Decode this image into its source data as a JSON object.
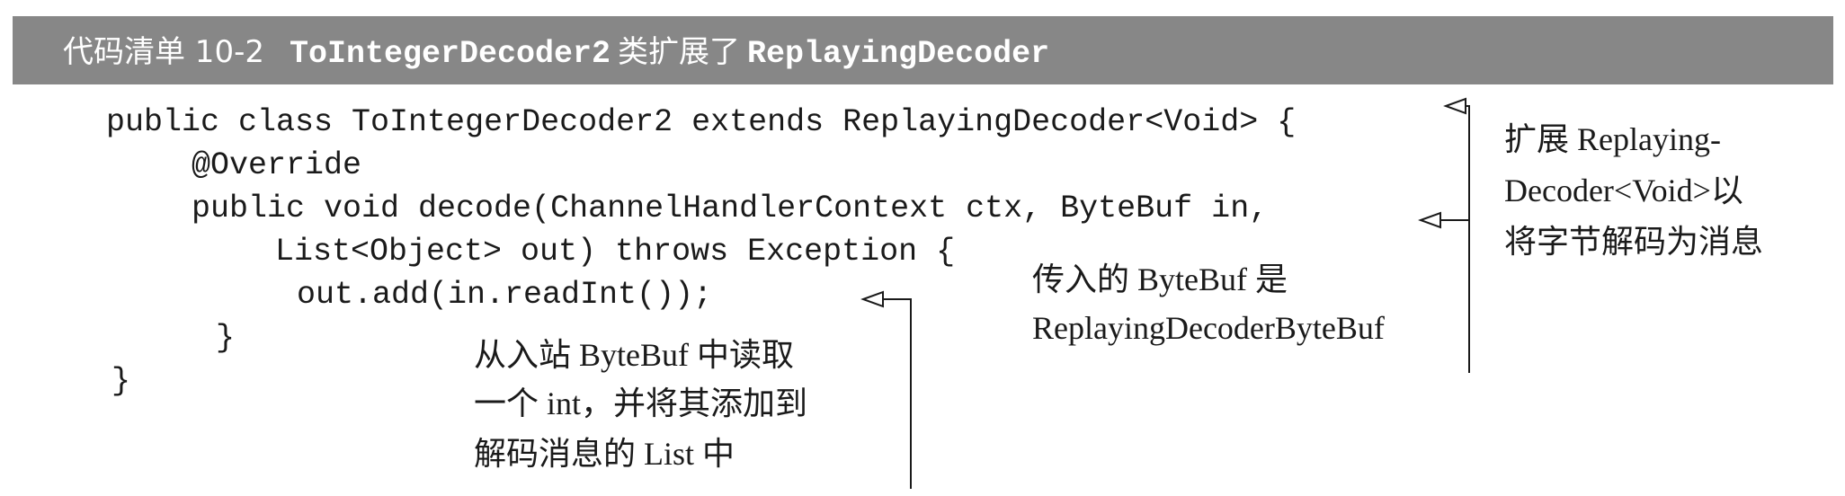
{
  "header": {
    "label": "代码清单 10-2",
    "class_name": "ToIntegerDecoder2",
    "middle": "类扩展了",
    "base_class": "ReplayingDecoder"
  },
  "code": {
    "lines": [
      "public class ToIntegerDecoder2 extends ReplayingDecoder<Void> {",
      "@Override",
      "public void decode(ChannelHandlerContext ctx, ByteBuf in,",
      "List<Object> out) throws Exception {",
      "out.add(in.readInt());",
      "}",
      "}"
    ]
  },
  "annotations": {
    "extend": [
      "扩展 Replaying-",
      "Decoder<Void>以",
      "将字节解码为消息"
    ],
    "bytebuf": [
      "传入的 ByteBuf 是",
      "ReplayingDecoderByteBuf"
    ],
    "read_int": [
      "从入站 ByteBuf 中读取",
      "一个 int，并将其添加到",
      "解码消息的 List 中"
    ]
  }
}
